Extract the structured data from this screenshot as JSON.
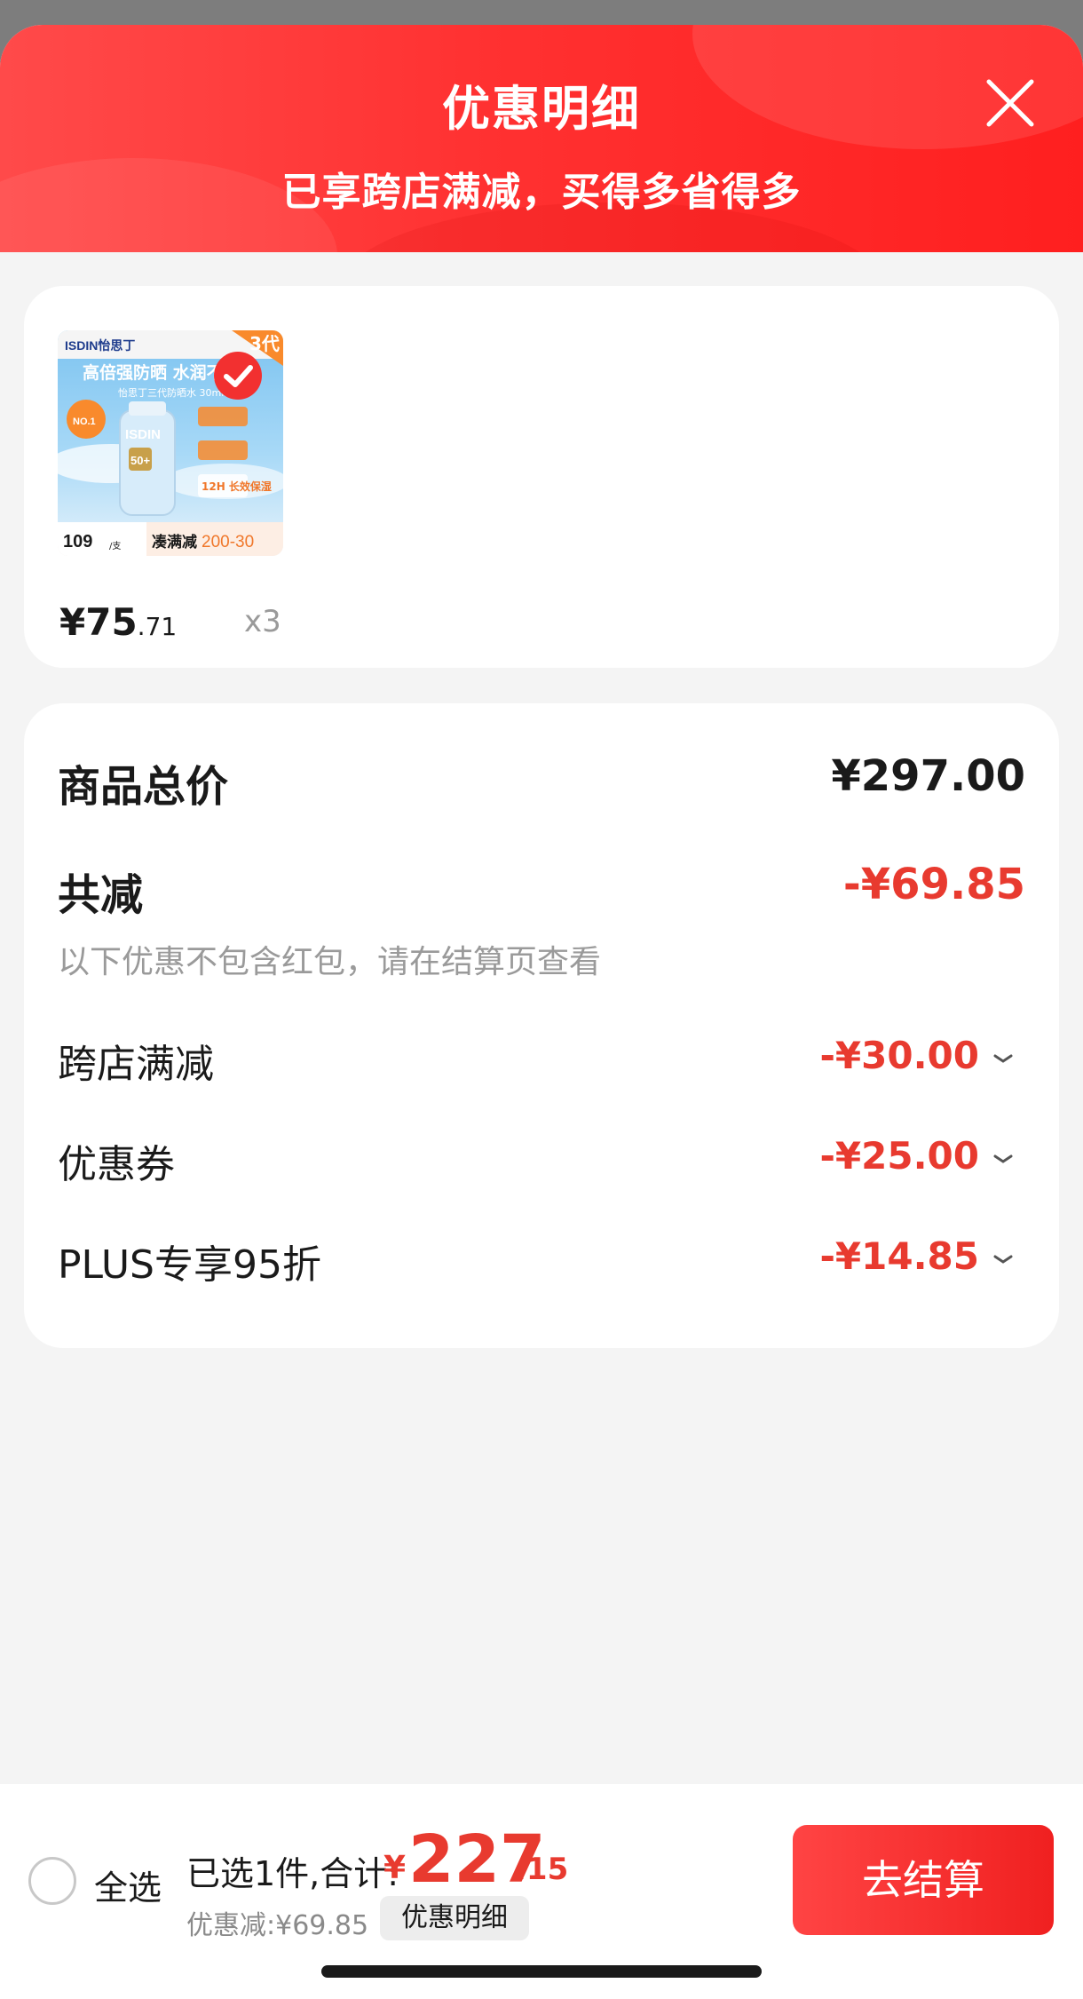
{
  "header": {
    "title": "优惠明细",
    "subtitle": "已享跨店满减，买得多省得多",
    "close_icon": "close-icon"
  },
  "product": {
    "image_texts": {
      "brand": "ISDIN怡思丁",
      "headline": "高倍强防晒 水润不",
      "product_line": "怡思丁三代防晒水 30ml",
      "gen_badge": "3代",
      "bottle_brand": "ISDIN",
      "bottle_spf": "50+",
      "feature": "12H 长效保湿",
      "side_tag": "NO.1",
      "footer_price": "109",
      "footer_unit": "/支",
      "footer_promo": "凑满减",
      "footer_promo_value": "200-30"
    },
    "price_int": "¥75",
    "price_dec": ".71",
    "quantity": "x3"
  },
  "summary": {
    "total_label": "商品总价",
    "total_value": "¥297.00",
    "reduce_label": "共减",
    "reduce_value": "-¥69.85",
    "note": "以下优惠不包含红包，请在结算页查看",
    "items": [
      {
        "label": "跨店满减",
        "value": "-¥30.00"
      },
      {
        "label": "优惠券",
        "value": "-¥25.00"
      },
      {
        "label": "PLUS专享95折",
        "value": "-¥14.85"
      }
    ]
  },
  "bottom_bar": {
    "select_all": "全选",
    "selected_text": "已选1件,合计:",
    "total_currency": "¥",
    "total_int": "227",
    "total_dec": ".15",
    "discount_text": "优惠减:¥69.85",
    "detail_chip": "优惠明细",
    "checkout": "去结算"
  },
  "colors": {
    "accent": "#e83a2f",
    "header_red": "#ff3131",
    "background": "#f4f4f4"
  }
}
